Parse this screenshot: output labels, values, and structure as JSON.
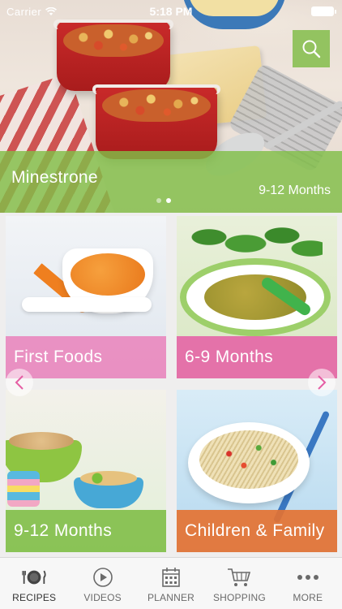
{
  "status_bar": {
    "carrier": "Carrier",
    "time": "5:18 PM"
  },
  "hero": {
    "title": "Minestrone",
    "subtitle": "9-12 Months",
    "dots": 2,
    "active_dot": 1
  },
  "search": {
    "icon": "search-icon"
  },
  "tiles": [
    {
      "label": "First Foods",
      "color": "#e984bc"
    },
    {
      "label": "6-9 Months",
      "color": "#e55ea4"
    },
    {
      "label": "9-12 Months",
      "color": "#81be48"
    },
    {
      "label": "Children & Family",
      "color": "#e47232"
    }
  ],
  "tabbar": {
    "items": [
      {
        "label": "RECIPES",
        "icon": "plate-cutlery-icon",
        "active": true
      },
      {
        "label": "VIDEOS",
        "icon": "play-icon",
        "active": false
      },
      {
        "label": "PLANNER",
        "icon": "calendar-icon",
        "active": false
      },
      {
        "label": "SHOPPING",
        "icon": "cart-icon",
        "active": false
      },
      {
        "label": "MORE",
        "icon": "more-icon",
        "active": false
      }
    ]
  },
  "colors": {
    "accent_green": "#81be48",
    "pink": "#e55ea4",
    "orange": "#e47232"
  }
}
